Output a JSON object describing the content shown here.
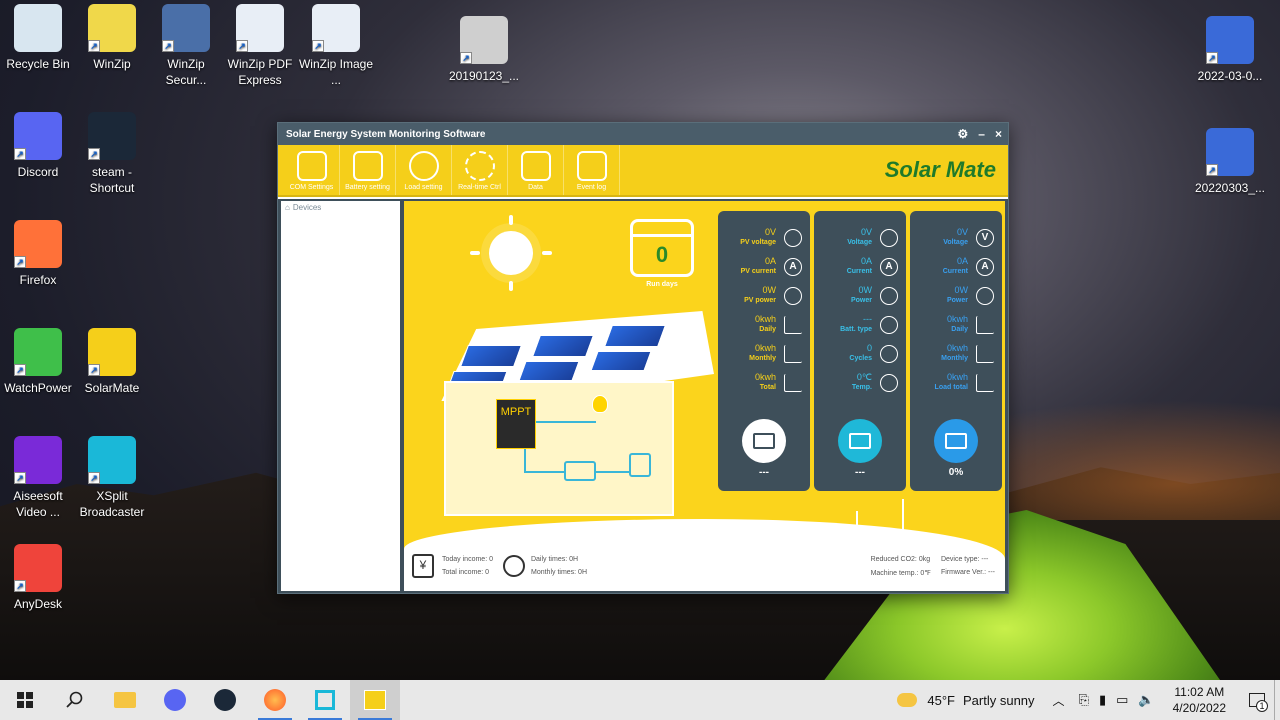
{
  "desktop": {
    "icons": [
      {
        "label": "Recycle Bin",
        "icon": "recycle-bin-icon",
        "color": "#d8e6f0"
      },
      {
        "label": "WinZip",
        "icon": "winzip-icon",
        "color": "#f0d84a"
      },
      {
        "label": "WinZip Secur...",
        "icon": "winzip-secure-icon",
        "color": "#4a6fa8"
      },
      {
        "label": "WinZip PDF Express",
        "icon": "pdf-icon",
        "color": "#e8eef6"
      },
      {
        "label": "WinZip Image ...",
        "icon": "image-icon",
        "color": "#e8eef6"
      },
      {
        "label": "20190123_...",
        "icon": "video-file-icon",
        "color": "#cfcfcf"
      },
      {
        "label": "2022-03-0...",
        "icon": "video-file-icon",
        "color": "#3a6ad8"
      },
      {
        "label": "Discord",
        "icon": "discord-icon",
        "color": "#5865f2"
      },
      {
        "label": "steam - Shortcut",
        "icon": "steam-icon",
        "color": "#1b2838"
      },
      {
        "label": "20220303_...",
        "icon": "video-file-icon",
        "color": "#3a6ad8"
      },
      {
        "label": "Firefox",
        "icon": "firefox-icon",
        "color": "#ff7139"
      },
      {
        "label": "WatchPower",
        "icon": "watchpower-icon",
        "color": "#3fbf4a"
      },
      {
        "label": "SolarMate",
        "icon": "solarmate-icon",
        "color": "#f5cf1a"
      },
      {
        "label": "Aiseesoft Video ...",
        "icon": "aiseesoft-icon",
        "color": "#7a2ad8"
      },
      {
        "label": "XSplit Broadcaster",
        "icon": "xsplit-icon",
        "color": "#1ab8d8"
      },
      {
        "label": "AnyDesk",
        "icon": "anydesk-icon",
        "color": "#ef443b"
      }
    ]
  },
  "window": {
    "title": "Solar Energy System Monitoring Software",
    "brand": "Solar Mate",
    "toolbar": [
      {
        "label": "COM Settings",
        "icon": "monitor-icon"
      },
      {
        "label": "Battery setting",
        "icon": "battery-icon"
      },
      {
        "label": "Load setting",
        "icon": "bulb-icon"
      },
      {
        "label": "Real-time Ctrl",
        "icon": "gear-icon"
      },
      {
        "label": "Data",
        "icon": "calendar-clock-icon"
      },
      {
        "label": "Event log",
        "icon": "log-icon"
      }
    ],
    "devices_header": "Devices",
    "run_days": {
      "value": "0",
      "label": "Run days"
    },
    "mppt_label": "MPPT",
    "pv_card": {
      "metrics": [
        {
          "value": "0V",
          "label": "PV voltage",
          "icon": "solar-panel-icon"
        },
        {
          "value": "0A",
          "label": "PV current",
          "icon": "ammeter-icon"
        },
        {
          "value": "0W",
          "label": "PV power",
          "icon": "wave-icon"
        },
        {
          "value": "0kwh",
          "label": "Daily",
          "icon": "line-chart-icon"
        },
        {
          "value": "0kwh",
          "label": "Monthly",
          "icon": "area-chart-icon"
        },
        {
          "value": "0kwh",
          "label": "Total",
          "icon": "bar-chart-icon"
        }
      ],
      "footer": "---",
      "value_color": "#f5cf1a"
    },
    "battery_card": {
      "metrics": [
        {
          "value": "0V",
          "label": "Voltage",
          "icon": "lightning-icon"
        },
        {
          "value": "0A",
          "label": "Current",
          "icon": "ammeter-icon"
        },
        {
          "value": "0W",
          "label": "Power",
          "icon": "wave-icon"
        },
        {
          "value": "---",
          "label": "Batt. type",
          "icon": "battery-cells-icon"
        },
        {
          "value": "0",
          "label": "Cycles",
          "icon": "recycle-icon"
        },
        {
          "value": "0℃",
          "label": "Temp.",
          "icon": "thermometer-icon"
        }
      ],
      "footer": "---",
      "value_color": "#39c0e8"
    },
    "load_card": {
      "metrics": [
        {
          "value": "0V",
          "label": "Voltage",
          "icon": "voltmeter-icon"
        },
        {
          "value": "0A",
          "label": "Current",
          "icon": "ammeter-icon"
        },
        {
          "value": "0W",
          "label": "Power",
          "icon": "wave-icon"
        },
        {
          "value": "0kwh",
          "label": "Daily",
          "icon": "line-chart-icon"
        },
        {
          "value": "0kwh",
          "label": "Monthly",
          "icon": "area-chart-icon"
        },
        {
          "value": "0kwh",
          "label": "Load total",
          "icon": "bar-chart-icon"
        }
      ],
      "footer": "0%",
      "value_color": "#39a0f0"
    },
    "bottom": {
      "today_income": "Today income:  0",
      "total_income": "Total income:  0",
      "daily_times": "Daily times:  0H",
      "monthly_times": "Monthly times:  0H",
      "reduced_co2": "Reduced CO2:  0kg",
      "machine_temp": "Machine temp.:  0℉",
      "device_type": "Device type:  ---",
      "firmware": "Firmware Ver.:  ---"
    }
  },
  "taskbar": {
    "weather_temp": "45°F",
    "weather_text": "Partly sunny",
    "time": "11:02 AM",
    "date": "4/20/2022",
    "notifications": "1"
  }
}
